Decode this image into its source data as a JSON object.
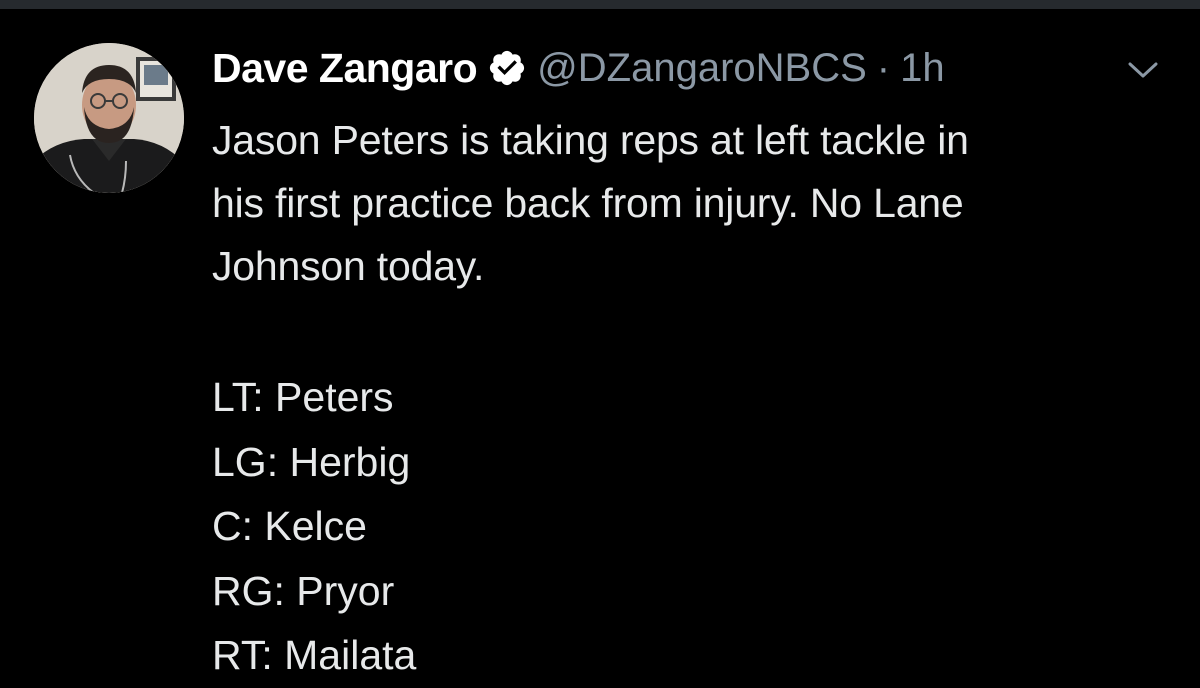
{
  "tweet": {
    "author": {
      "display_name": "Dave Zangaro",
      "verified": true,
      "handle": "@DZangaroNBCS",
      "separator": "·",
      "time_ago": "1h"
    },
    "text_lines": [
      "Jason Peters is taking reps at left tackle in",
      "his first practice back from injury. No Lane",
      "Johnson today."
    ],
    "lineup": [
      {
        "position": "LT",
        "player": "Peters",
        "text": "LT: Peters"
      },
      {
        "position": "LG",
        "player": "Herbig",
        "text": "LG: Herbig"
      },
      {
        "position": "C",
        "player": "Kelce",
        "text": "C: Kelce"
      },
      {
        "position": "RG",
        "player": "Pryor",
        "text": "RG: Pryor"
      },
      {
        "position": "RT",
        "player": "Mailata",
        "text": "RT: Mailata"
      }
    ]
  },
  "icons": {
    "verified": "verified-badge-icon",
    "menu": "chevron-down-icon"
  },
  "colors": {
    "background": "#000000",
    "primary_text": "#e7e9ea",
    "secondary_text": "#8b98a5",
    "badge": "#ffffff"
  }
}
